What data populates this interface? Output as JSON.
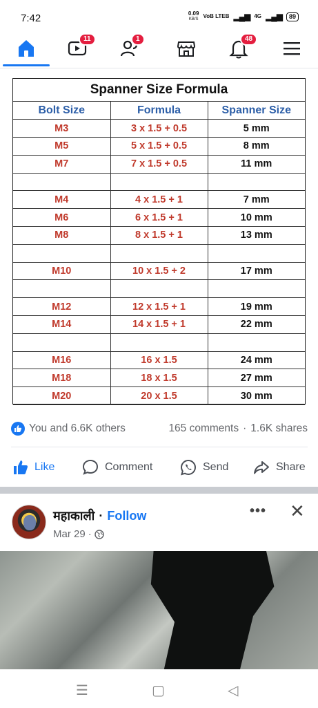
{
  "status": {
    "time": "7:42",
    "speed_value": "0.09",
    "speed_unit": "KB/S",
    "volte": "VoB LTEB",
    "network": "4G",
    "battery": "89"
  },
  "nav": {
    "watch_badge": "11",
    "friends_badge": "1",
    "notifications_badge": "48",
    "icons": [
      "home-icon",
      "watch-icon",
      "friends-icon",
      "marketplace-icon",
      "bell-icon",
      "menu-icon"
    ]
  },
  "table": {
    "title": "Spanner Size Formula",
    "headers": [
      "Bolt Size",
      "Formula",
      "Spanner Size"
    ],
    "rows": [
      [
        "M3",
        "3 x 1.5 + 0.5",
        "5 mm"
      ],
      [
        "M5",
        "5 x 1.5 + 0.5",
        "8 mm"
      ],
      [
        "M7",
        "7 x 1.5 + 0.5",
        "11 mm"
      ],
      [
        "",
        "",
        ""
      ],
      [
        "M4",
        "4 x 1.5 + 1",
        "7 mm"
      ],
      [
        "M6",
        "6 x 1.5 + 1",
        "10 mm"
      ],
      [
        "M8",
        "8 x 1.5 + 1",
        "13 mm"
      ],
      [
        "",
        "",
        ""
      ],
      [
        "M10",
        "10 x 1.5 + 2",
        "17 mm"
      ],
      [
        "",
        "",
        ""
      ],
      [
        "M12",
        "12 x 1.5 + 1",
        "19 mm"
      ],
      [
        "M14",
        "14 x 1.5 + 1",
        "22 mm"
      ],
      [
        "",
        "",
        ""
      ],
      [
        "M16",
        "16 x 1.5",
        "24 mm"
      ],
      [
        "M18",
        "18 x 1.5",
        "27 mm"
      ],
      [
        "M20",
        "20 x 1.5",
        "30 mm"
      ]
    ]
  },
  "post": {
    "reactions_text": "You and 6.6K others",
    "comments_text": "165 comments",
    "shares_text": "1.6K shares",
    "actions": {
      "like": "Like",
      "comment": "Comment",
      "send": "Send",
      "share": "Share"
    }
  },
  "post2": {
    "author": "महाकाली",
    "follow": "Follow",
    "date": "Mar 29"
  },
  "colors": {
    "brand_blue": "#1877f2",
    "badge_red": "#e41e3f",
    "table_header_blue": "#2d5fa8",
    "table_red": "#c0392b"
  }
}
